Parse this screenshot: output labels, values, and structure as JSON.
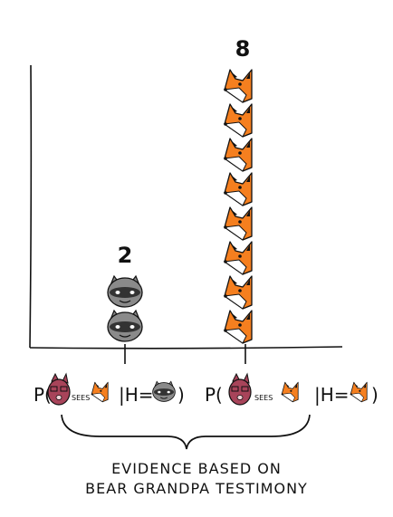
{
  "chart_data": {
    "type": "bar",
    "categories": [
      "raccoon",
      "fox"
    ],
    "values": [
      2,
      8
    ],
    "value_labels": [
      "2",
      "8"
    ],
    "ylim": [
      0,
      9
    ],
    "grid": false,
    "icon_units": [
      "raccoon-icon",
      "fox-icon"
    ],
    "tick_labels": [
      {
        "prefix": "P(",
        "sees_word": "SEES",
        "given": "|H=",
        "hypothesis_icon": "raccoon-icon",
        "suffix": ")"
      },
      {
        "prefix": "P(",
        "sees_word": "SEES",
        "given": "|H=",
        "hypothesis_icon": "fox-icon",
        "suffix": ")"
      }
    ]
  },
  "caption": {
    "line1": "EVIDENCE BASED ON",
    "line2": "BEAR GRANDPA TESTIMONY"
  },
  "colors": {
    "fox_orange": "#f57f1f",
    "fox_white": "#ffffff",
    "raccoon_gray": "#8a8a8a",
    "raccoon_mask": "#333333",
    "bear_maroon": "#a8445a",
    "ink": "#111111"
  }
}
